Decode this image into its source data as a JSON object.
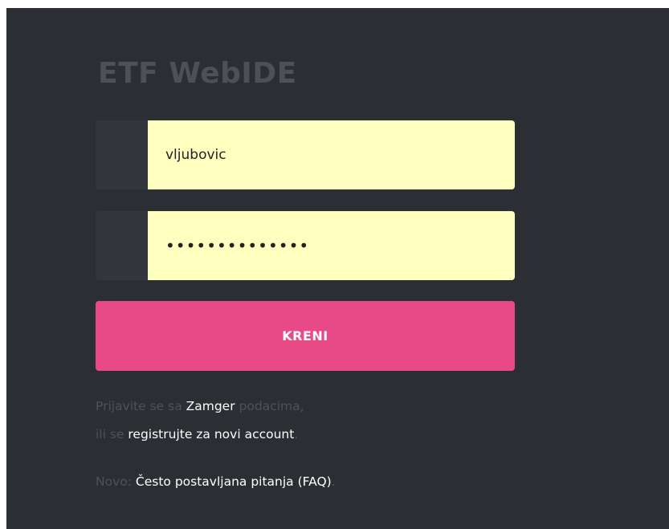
{
  "login": {
    "title": "ETF WebIDE",
    "username": {
      "value": "vljubovic",
      "icon": "user-icon"
    },
    "password": {
      "value": "vljubovic12345",
      "icon": "lock-icon"
    },
    "submit_label": "KRENI"
  },
  "info": {
    "line1_pre": "Prijavite se sa ",
    "line1_link": "Zamger",
    "line1_post": " podacima,",
    "line2_pre": "ili se ",
    "line2_link": "registrujte za novi account",
    "line2_post": ".",
    "line3_pre": "Novo: ",
    "line3_link": "Često postavljana pitanja (FAQ)",
    "line3_post": "."
  },
  "colors": {
    "background": "#2b2e33",
    "input_background": "#ffffc0",
    "accent": "#e84a86",
    "muted_text": "#4e5259",
    "link_text": "#ffffff"
  }
}
